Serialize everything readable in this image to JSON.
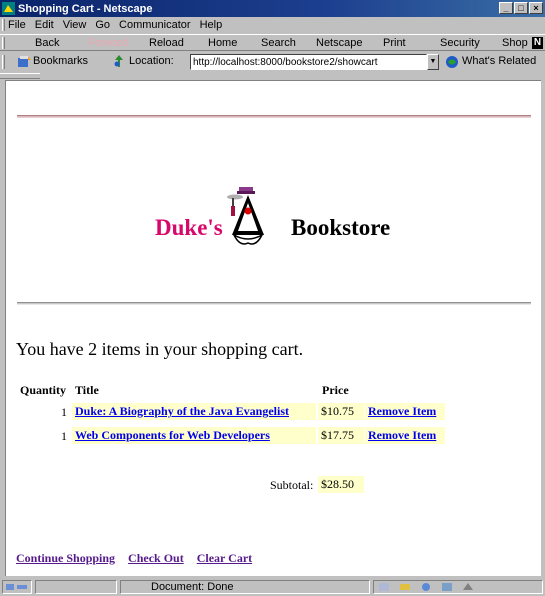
{
  "window": {
    "title": "Shopping Cart - Netscape",
    "controls": [
      "_",
      "□",
      "×"
    ]
  },
  "menu": [
    "File",
    "Edit",
    "View",
    "Go",
    "Communicator",
    "Help"
  ],
  "toolbar": {
    "back": "Back",
    "forward": "Forward",
    "reload": "Reload",
    "home": "Home",
    "search": "Search",
    "netscape": "Netscape",
    "print": "Print",
    "security": "Security",
    "shop": "Shop",
    "logo": "N"
  },
  "location_bar": {
    "bookmarks": "Bookmarks",
    "location_label": "Location:",
    "url": "http://localhost:8000/bookstore2/showcart",
    "whats_related": "What's Related"
  },
  "banner": {
    "dukes": "Duke's",
    "bookstore": "Bookstore"
  },
  "cart": {
    "message": "You have 2 items in your shopping cart.",
    "headers": {
      "quantity": "Quantity",
      "title": "Title",
      "price": "Price"
    },
    "items": [
      {
        "quantity": "1",
        "title": "Duke: A Biography of the Java Evangelist",
        "price": "$10.75",
        "remove": "Remove Item"
      },
      {
        "quantity": "1",
        "title": "Web Components for Web Developers",
        "price": "$17.75",
        "remove": "Remove Item"
      }
    ],
    "subtotal_label": "Subtotal:",
    "subtotal_value": "$28.50"
  },
  "links": {
    "continue": "Continue Shopping",
    "checkout": "Check Out",
    "clear": "Clear Cart"
  },
  "status": {
    "text": "Document: Done"
  },
  "colors": {
    "title_bar": "#0a246a",
    "brand_pink": "#d6086c",
    "link_blue": "#0000ee",
    "visited_link": "#551a8b",
    "highlight_yellow": "#ffffcc"
  }
}
